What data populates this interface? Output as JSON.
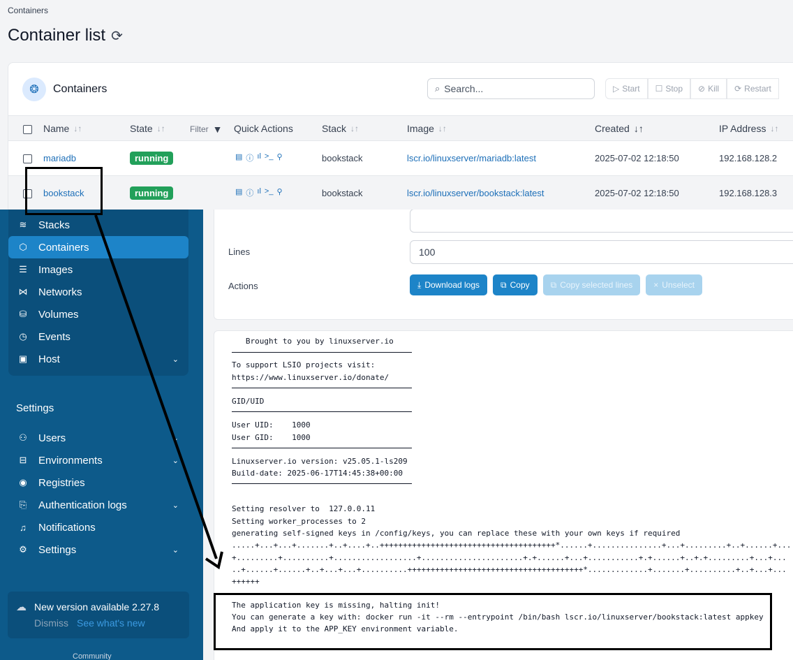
{
  "breadcrumb": "Containers",
  "page_title": "Container list",
  "card_title": "Containers",
  "search": {
    "placeholder": "Search..."
  },
  "toolbar": {
    "start": "Start",
    "stop": "Stop",
    "kill": "Kill",
    "restart": "Restart"
  },
  "columns": {
    "name": "Name",
    "state": "State",
    "filter": "Filter",
    "quick_actions": "Quick Actions",
    "stack": "Stack",
    "image": "Image",
    "created": "Created",
    "ip": "IP Address"
  },
  "rows": [
    {
      "name": "mariadb",
      "state": "running",
      "stack": "bookstack",
      "image": "lscr.io/linuxserver/mariadb:latest",
      "created": "2025-07-02 12:18:50",
      "ip": "192.168.128.2"
    },
    {
      "name": "bookstack",
      "state": "running",
      "stack": "bookstack",
      "image": "lscr.io/linuxserver/bookstack:latest",
      "created": "2025-07-02 12:18:50",
      "ip": "192.168.128.3"
    }
  ],
  "sidebar": {
    "items": [
      {
        "label": "Stacks",
        "icon": "stacks-icon"
      },
      {
        "label": "Containers",
        "icon": "container-icon",
        "active": true
      },
      {
        "label": "Images",
        "icon": "images-icon"
      },
      {
        "label": "Networks",
        "icon": "network-icon"
      },
      {
        "label": "Volumes",
        "icon": "volume-icon"
      },
      {
        "label": "Events",
        "icon": "clock-icon"
      },
      {
        "label": "Host",
        "icon": "host-icon"
      }
    ],
    "settings_title": "Settings",
    "settings_items": [
      {
        "label": "Users",
        "icon": "users-icon"
      },
      {
        "label": "Environments",
        "icon": "environments-icon"
      },
      {
        "label": "Registries",
        "icon": "registries-icon"
      },
      {
        "label": "Authentication logs",
        "icon": "auth-logs-icon"
      },
      {
        "label": "Notifications",
        "icon": "bell-icon"
      },
      {
        "label": "Settings",
        "icon": "gear-icon"
      }
    ],
    "update": {
      "title": "New version available 2.27.8",
      "dismiss": "Dismiss",
      "whats_new": "See what's new"
    },
    "community": "Community"
  },
  "log_settings": {
    "lines_label": "Lines",
    "lines_value": "100",
    "actions_label": "Actions"
  },
  "log_actions": {
    "download": "Download logs",
    "copy": "Copy",
    "copy_selected": "Copy selected lines",
    "unselect": "Unselect"
  },
  "log_lines": [
    "   Brought to you by linuxserver.io",
    "To support LSIO projects visit:",
    "https://www.linuxserver.io/donate/",
    "GID/UID",
    "User UID:    1000",
    "User GID:    1000",
    "Linuxserver.io version: v25.05.1-ls209",
    "Build-date: 2025-06-17T14:45:38+00:00",
    "Setting resolver to  127.0.0.11",
    "Setting worker_processes to 2",
    "generating self-signed keys in /config/keys, you can replace these with your own keys if required",
    ".....+...+...+.......+..+....+..++++++++++++++++++++++++++++++++++++++*......+...............+...+.........+..+......+...",
    "+.........+..........+..................+......................+.+......+...+...........+.+......+..+.+.........+...+...",
    "..+......+......+..+...+...+..........++++++++++++++++++++++++++++++++++++++*.............+.......+..........+..+...+...",
    "++++++",
    "The application key is missing, halting init!",
    "You can generate a key with: docker run -it --rm --entrypoint /bin/bash lscr.io/linuxserver/bookstack:latest appkey",
    "And apply it to the APP_KEY environment variable."
  ]
}
